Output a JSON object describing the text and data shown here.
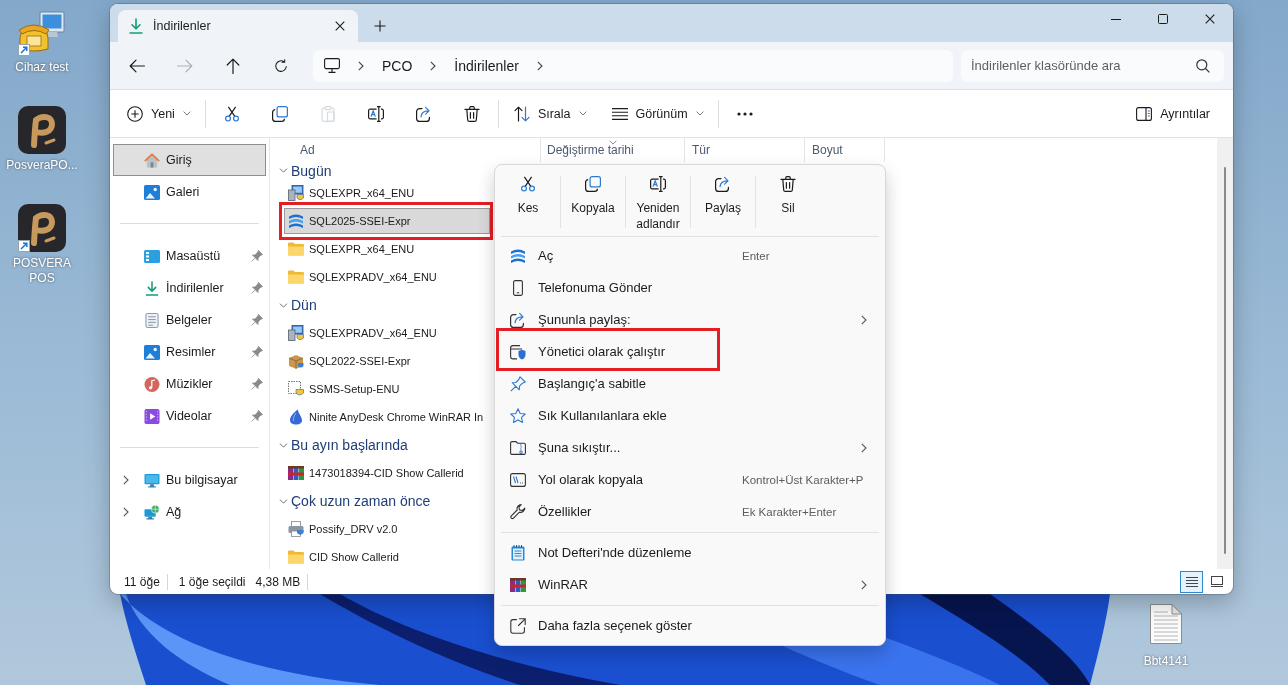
{
  "desktop": {
    "left_icons": [
      {
        "label": "Cihaz test",
        "kind": "device-test",
        "shortcut": true
      },
      {
        "label": "PosveraPO...",
        "kind": "posvera",
        "shortcut": false
      },
      {
        "label": "POSVERA POS",
        "kind": "posvera",
        "shortcut": true
      }
    ],
    "right_icons": [
      {
        "label": "Bbt4141",
        "kind": "text-file",
        "shortcut": false
      }
    ]
  },
  "explorer": {
    "tabs": [
      {
        "label": "İndirilenler",
        "selected": true
      }
    ],
    "nav_buttons": [
      {
        "kind": "back",
        "disabled": false
      },
      {
        "kind": "forward",
        "disabled": true
      },
      {
        "kind": "up",
        "disabled": false
      },
      {
        "kind": "refresh",
        "disabled": false
      }
    ],
    "breadcrumb": [
      "PCO",
      "İndirilenler"
    ],
    "search": {
      "placeholder": "İndirilenler klasöründe ara"
    },
    "toolbar": {
      "groups": [
        {
          "buttons": [
            {
              "kind": "new",
              "label": "Yeni",
              "disabled": false
            }
          ]
        },
        {
          "buttons": [
            {
              "kind": "cut",
              "disabled": false
            },
            {
              "kind": "copy",
              "disabled": false
            },
            {
              "kind": "paste",
              "disabled": true
            },
            {
              "kind": "rename",
              "disabled": false
            },
            {
              "kind": "share",
              "disabled": false
            },
            {
              "kind": "delete",
              "disabled": false
            }
          ]
        },
        {
          "buttons": [
            {
              "kind": "sort",
              "label": "Sırala",
              "disabled": false
            },
            {
              "kind": "view",
              "label": "Görünüm",
              "disabled": false
            }
          ]
        },
        {
          "buttons": [
            {
              "kind": "more",
              "disabled": false
            }
          ]
        }
      ],
      "details_pane": {
        "label": "Ayrıntılar"
      }
    },
    "sidebar": {
      "sections": [
        {
          "items": [
            {
              "label": "Giriş",
              "kind": "home",
              "selected": true
            },
            {
              "label": "Galeri",
              "kind": "gallery",
              "selected": false
            }
          ]
        },
        {
          "items": [
            {
              "label": "Masaüstü",
              "kind": "desktop",
              "selected": false,
              "pinned": true
            },
            {
              "label": "İndirilenler",
              "kind": "downloads",
              "selected": false,
              "pinned": true
            },
            {
              "label": "Belgeler",
              "kind": "documents",
              "selected": false,
              "pinned": true
            },
            {
              "label": "Resimler",
              "kind": "pictures",
              "selected": false,
              "pinned": true
            },
            {
              "label": "Müzikler",
              "kind": "music",
              "selected": false,
              "pinned": true
            },
            {
              "label": "Videolar",
              "kind": "videos",
              "selected": false,
              "pinned": true
            }
          ]
        },
        {
          "items": [
            {
              "label": "Bu bilgisayar",
              "kind": "computer",
              "selected": false,
              "expanded": false
            },
            {
              "label": "Ağ",
              "kind": "network",
              "selected": false,
              "expanded": false
            }
          ]
        }
      ]
    },
    "file_list": {
      "columns": [
        {
          "label": "Ad",
          "sorted": false
        },
        {
          "label": "Değiştirme tarihi",
          "sorted": true
        },
        {
          "label": "Tür",
          "sorted": false
        },
        {
          "label": "Boyut",
          "sorted": false
        }
      ],
      "groups": [
        {
          "title": "Bugün",
          "expanded": true,
          "rows": [
            {
              "name": "SQLEXPR_x64_ENU",
              "kind": "installer",
              "selected": false,
              "highlighted": false
            },
            {
              "name": "SQL2025-SSEI-Expr",
              "kind": "sql-setup",
              "selected": true,
              "highlighted": true
            },
            {
              "name": "SQLEXPR_x64_ENU",
              "kind": "folder",
              "selected": false,
              "highlighted": false
            },
            {
              "name": "SQLEXPRADV_x64_ENU",
              "kind": "folder",
              "selected": false,
              "highlighted": false
            }
          ]
        },
        {
          "title": "Dün",
          "expanded": true,
          "rows": [
            {
              "name": "SQLEXPRADV_x64_ENU",
              "kind": "installer",
              "selected": false,
              "highlighted": false
            },
            {
              "name": "SQL2022-SSEI-Expr",
              "kind": "package",
              "selected": false,
              "highlighted": false
            },
            {
              "name": "SSMS-Setup-ENU",
              "kind": "setup",
              "selected": false,
              "highlighted": false
            },
            {
              "name": "Ninite AnyDesk Chrome WinRAR In",
              "kind": "ninite",
              "selected": false,
              "highlighted": false
            }
          ]
        },
        {
          "title": "Bu ayın başlarında",
          "expanded": true,
          "rows": [
            {
              "name": "1473018394-CID Show Callerid",
              "kind": "archive",
              "selected": false,
              "highlighted": false
            }
          ]
        },
        {
          "title": "Çok uzun zaman önce",
          "expanded": true,
          "rows": [
            {
              "name": "Possify_DRV v2.0",
              "kind": "printer-setup",
              "selected": false,
              "highlighted": false
            },
            {
              "name": "CID Show Callerid",
              "kind": "folder",
              "selected": false,
              "highlighted": false
            }
          ]
        }
      ]
    },
    "status_bar": {
      "item_count": "11 öğe",
      "selection": "1 öğe seçildi",
      "selection_size": "4,38 MB",
      "view_buttons": [
        {
          "kind": "details",
          "selected": true
        },
        {
          "kind": "tiles",
          "selected": false
        }
      ]
    }
  },
  "context_menu": {
    "actions": [
      {
        "kind": "cut",
        "label": "Kes"
      },
      {
        "kind": "copy",
        "label": "Kopyala"
      },
      {
        "kind": "rename",
        "label": "Yeniden adlandır"
      },
      {
        "kind": "share",
        "label": "Paylaş"
      },
      {
        "kind": "delete",
        "label": "Sil"
      }
    ],
    "sections": [
      {
        "items": [
          {
            "kind": "open",
            "label": "Aç",
            "shortcut": "Enter",
            "submenu": false,
            "highlighted": false
          },
          {
            "kind": "send-to-phone",
            "label": "Telefonuma Gönder",
            "submenu": false,
            "highlighted": false
          },
          {
            "kind": "share-with",
            "label": "Şununla paylaş:",
            "submenu": true,
            "highlighted": false
          },
          {
            "kind": "run-as-admin",
            "label": "Yönetici olarak çalıştır",
            "submenu": false,
            "highlighted": true
          },
          {
            "kind": "pin-start",
            "label": "Başlangıç'a sabitle",
            "submenu": false,
            "highlighted": false
          },
          {
            "kind": "favorite",
            "label": "Sık Kullanılanlara ekle",
            "submenu": false,
            "highlighted": false
          },
          {
            "kind": "compress",
            "label": "Şuna sıkıştır...",
            "submenu": true,
            "highlighted": false
          },
          {
            "kind": "copy-path",
            "label": "Yol olarak kopyala",
            "shortcut": "Kontrol+Üst Karakter+P",
            "submenu": false,
            "highlighted": false
          },
          {
            "kind": "properties",
            "label": "Özellikler",
            "shortcut": "Ek Karakter+Enter",
            "submenu": false,
            "highlighted": false
          }
        ]
      },
      {
        "items": [
          {
            "kind": "notepad",
            "label": "Not Defteri'nde düzenleme",
            "submenu": false,
            "highlighted": false
          },
          {
            "kind": "winrar",
            "label": "WinRAR",
            "submenu": true,
            "highlighted": false
          }
        ]
      },
      {
        "items": [
          {
            "kind": "more-options",
            "label": "Daha fazla seçenek göster",
            "submenu": false,
            "highlighted": false
          }
        ]
      }
    ]
  }
}
